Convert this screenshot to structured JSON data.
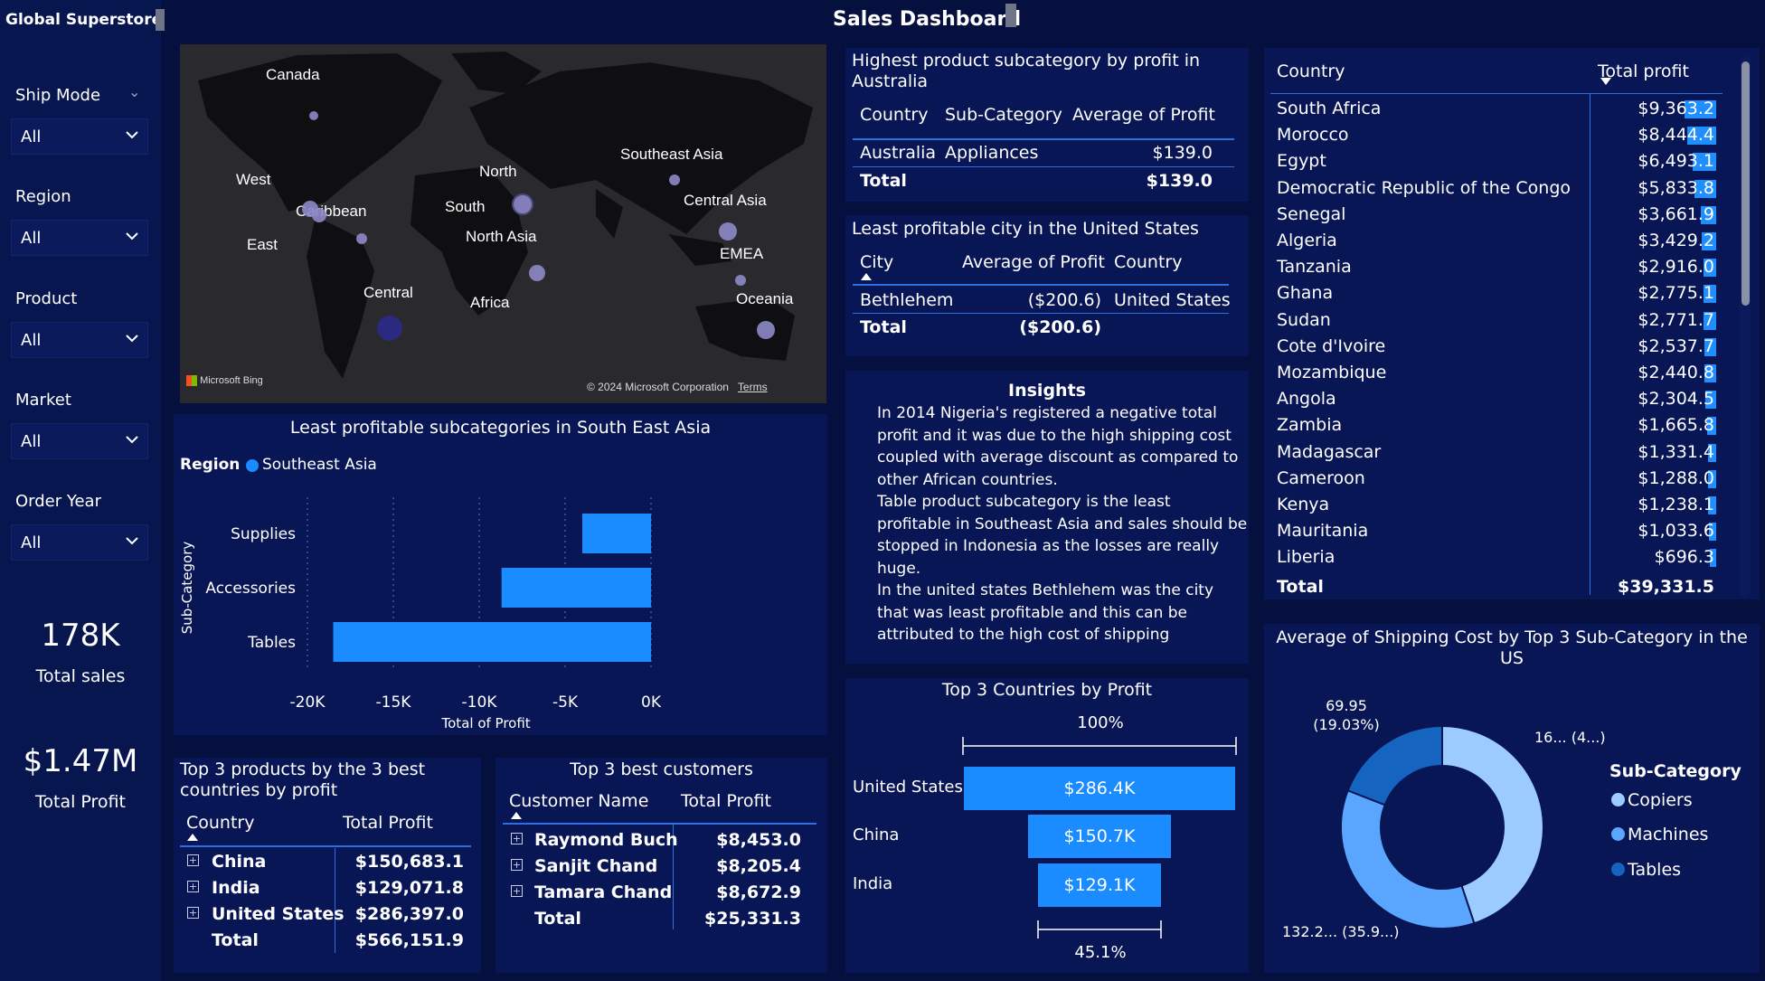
{
  "brand": "Global Superstore",
  "title": "Sales Dashboard",
  "filters": [
    {
      "label": "Ship Mode",
      "value": "All"
    },
    {
      "label": "Region",
      "value": "All"
    },
    {
      "label": "Product",
      "value": "All"
    },
    {
      "label": "Market",
      "value": "All"
    },
    {
      "label": "Order Year",
      "value": "All"
    }
  ],
  "kpis": {
    "sales_value": "178K",
    "sales_label": "Total sales",
    "profit_value": "$1.47M",
    "profit_label": "Total Profit"
  },
  "map": {
    "labels": [
      "Canada",
      "West",
      "Caribbean",
      "East",
      "North",
      "South",
      "North Asia",
      "Southeast Asia",
      "Central Asia",
      "EMEA",
      "Africa",
      "Central",
      "Oceania"
    ],
    "bing": "Microsoft Bing",
    "copyright": "© 2024 Microsoft Corporation",
    "terms": "Terms"
  },
  "top_subcat": {
    "title": "Highest product subcategory by profit in Australia",
    "headers": [
      "Country",
      "Sub-Category",
      "Average of Profit"
    ],
    "row": [
      "Australia",
      "Appliances",
      "$139.0"
    ],
    "total_label": "Total",
    "total_value": "$139.0"
  },
  "least_city": {
    "title": "Least profitable city in the United States",
    "headers": [
      "City",
      "Average of Profit",
      "Country"
    ],
    "row": [
      "Bethlehem",
      "($200.6)",
      "United States"
    ],
    "total_label": "Total",
    "total_value": "($200.6)"
  },
  "insights": {
    "title": "Insights",
    "text": "In 2014 Nigeria's registered a negative total profit and it was due to the high shipping cost coupled with average discount as compared to other African countries.\nTable product subcategory is the least profitable in Southeast Asia and sales should be stopped in Indonesia as the losses are really huge.\nIn the united states Bethlehem was the city that was least profitable and this can be attributed to the high cost of shipping"
  },
  "country_profit": {
    "headers": [
      "Country",
      "Total profit"
    ],
    "rows": [
      {
        "country": "South Africa",
        "profit": "$9,363.2",
        "share": 1.0
      },
      {
        "country": "Morocco",
        "profit": "$8,444.4",
        "share": 0.9
      },
      {
        "country": "Egypt",
        "profit": "$6,493.1",
        "share": 0.69
      },
      {
        "country": "Democratic Republic of the Congo",
        "profit": "$5,833.8",
        "share": 0.62
      },
      {
        "country": "Senegal",
        "profit": "$3,661.9",
        "share": 0.39
      },
      {
        "country": "Algeria",
        "profit": "$3,429.2",
        "share": 0.37
      },
      {
        "country": "Tanzania",
        "profit": "$2,916.0",
        "share": 0.31
      },
      {
        "country": "Ghana",
        "profit": "$2,775.1",
        "share": 0.3
      },
      {
        "country": "Sudan",
        "profit": "$2,771.7",
        "share": 0.3
      },
      {
        "country": "Cote d'Ivoire",
        "profit": "$2,537.7",
        "share": 0.27
      },
      {
        "country": "Mozambique",
        "profit": "$2,440.8",
        "share": 0.26
      },
      {
        "country": "Angola",
        "profit": "$2,304.5",
        "share": 0.25
      },
      {
        "country": "Zambia",
        "profit": "$1,665.8",
        "share": 0.18
      },
      {
        "country": "Madagascar",
        "profit": "$1,331.4",
        "share": 0.14
      },
      {
        "country": "Cameroon",
        "profit": "$1,288.0",
        "share": 0.14
      },
      {
        "country": "Kenya",
        "profit": "$1,238.1",
        "share": 0.13
      },
      {
        "country": "Mauritania",
        "profit": "$1,033.6",
        "share": 0.11
      },
      {
        "country": "Liberia",
        "profit": "$696.3",
        "share": 0.07
      }
    ],
    "total_label": "Total",
    "total_value": "$39,331.5"
  },
  "top3_products": {
    "title": "Top 3 products by the 3 best countries by profit",
    "headers": [
      "Country",
      "Total Profit"
    ],
    "rows": [
      {
        "country": "China",
        "profit": "$150,683.1"
      },
      {
        "country": "India",
        "profit": "$129,071.8"
      },
      {
        "country": "United States",
        "profit": "$286,397.0"
      }
    ],
    "total_label": "Total",
    "total_value": "$566,151.9"
  },
  "top3_customers": {
    "title": "Top 3 best customers",
    "headers": [
      "Customer Name",
      "Total Profit"
    ],
    "rows": [
      {
        "name": "Raymond Buch",
        "profit": "$8,453.0"
      },
      {
        "name": "Sanjit Chand",
        "profit": "$8,205.4"
      },
      {
        "name": "Tamara Chand",
        "profit": "$8,672.9"
      }
    ],
    "total_label": "Total",
    "total_value": "$25,331.3"
  },
  "colors": {
    "background": "#05103f",
    "panel": "#081656",
    "accent": "#1a8cff",
    "donut_dark": "#1565c0",
    "donut_mid": "#5aa6ff",
    "donut_light": "#9ccbff"
  },
  "chart_data": [
    {
      "type": "bar",
      "title": "Least profitable subcategories in South East Asia",
      "legend_title": "Region",
      "legend_item": "Southeast Asia",
      "orientation": "horizontal",
      "categories": [
        "Supplies",
        "Accessories",
        "Tables"
      ],
      "values": [
        -4000,
        -8700,
        -18500
      ],
      "ylabel": "Sub-Category",
      "xlabel": "Total of Profit",
      "xlim": [
        -20000,
        0
      ],
      "ticks": [
        "-20K",
        "-15K",
        "-10K",
        "-5K",
        "0K"
      ],
      "tick_values": [
        -20000,
        -15000,
        -10000,
        -5000,
        0
      ]
    },
    {
      "type": "bar",
      "title": "Top 3 Countries by Profit",
      "orientation": "funnel",
      "categories": [
        "United States",
        "China",
        "India"
      ],
      "values": [
        286.4,
        150.7,
        129.1
      ],
      "value_labels": [
        "$286.4K",
        "$150.7K",
        "$129.1K"
      ],
      "top_pct": "100%",
      "bottom_pct": "45.1%"
    },
    {
      "type": "pie",
      "title": "Average of Shipping Cost by Top 3 Sub-Category in the US",
      "legend_title": "Sub-Category",
      "categories": [
        "Copiers",
        "Machines",
        "Tables"
      ],
      "values": [
        164.6,
        132.2,
        69.95
      ],
      "labels": [
        "16... (4...)",
        "132.2... (35.9...)",
        "69.95\n(19.03%)"
      ]
    }
  ]
}
